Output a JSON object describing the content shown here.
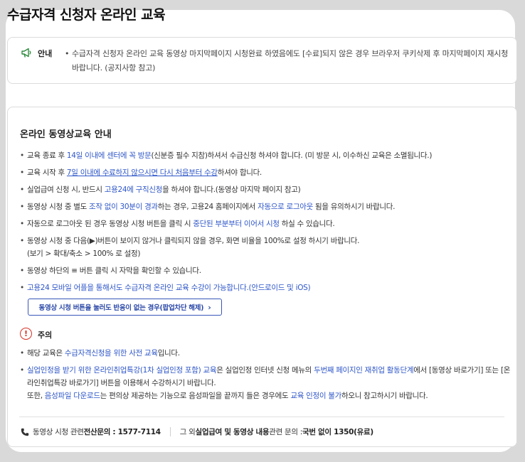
{
  "page": {
    "title": "수급자격 신청자 온라인 교육"
  },
  "notice": {
    "label": "안내",
    "bullet": "•",
    "text": "수급자격 신청자 온라인 교육 동영상 마지막페이지 시청완료 하였음에도 [수료]되지 않은 경우 브라우저 쿠키삭제 후 마지막페이지 재시청 바랍니다. (공지사항 참고)"
  },
  "guide": {
    "title": "온라인 동영상교육 안내",
    "items": [
      {
        "a": "교육 종료 후 ",
        "b": "14일 이내에 센터에 꼭 방문",
        "c": "(신분증 필수 지참)하셔서 수급신청 하셔야 합니다. (미 방문 시, 이수하신 교육은 소멸됩니다.)"
      },
      {
        "a": "교육 시작 후 ",
        "b": "7일 이내에 수료하지 않으시면 다시 처음부터 수강",
        "c": "하셔야 합니다."
      },
      {
        "a": "실업급여 신청 시, 반드시 ",
        "b": "고용24에 구직신청",
        "c": "을 하셔야 합니다.(동영상 마지막 페이지 참고)"
      },
      {
        "a": "동영상 시청 중 별도 ",
        "b": "조작 없이 30분이 경과",
        "c": "하는 경우, 고용24 홈페이지에서 ",
        "d": "자동으로 로그아웃",
        "e": " 됨을 유의하시기 바랍니다."
      },
      {
        "a": "자동으로 로그아웃 된 경우 동영상 시청 버튼을 클릭 시 ",
        "b": "중단된 부분부터 이어서 시청",
        "c": " 하실 수 있습니다."
      },
      {
        "a": "동영상 시청 중 다음(▶)버튼이 보이지 않거나 클릭되지 않을 경우, 화면 비율을 100%로 설정 하시기 바랍니다.",
        "b": "(보기 > 확대/축소 > 100% 로 설정)"
      },
      {
        "a": "동영상 하단의 ≡ 버튼 클릭 시 자막을 확인할 수 있습니다."
      },
      {
        "a": "고용24 모바일 어플을 통해서도 수급자격 온라인 교육 수강이 가능합니다.(안드로이드 및 iOS)"
      }
    ],
    "popup_button": "동영상 시청 버튼을 눌러도 반응이 없는 경우(팝업차단 해제)",
    "chevron": "›"
  },
  "caution": {
    "label": "주의",
    "symbol": "!",
    "items": [
      {
        "a": "해당 교육은 ",
        "b": "수급자격신청을 위한 사전 교육",
        "c": "입니다."
      },
      {
        "a": "실업인정을 받기 위한 온라인취업특강(1차 실업인정 포함) 교육",
        "b": "은 실업인정 인터넷 신청 메뉴의 ",
        "c": "두번째 페이지인 재취업 활동단계",
        "d": "에서 [동영상 바로가기] 또는 [온라인취업특강 바로가기] 버튼을 이용해서 수강하시기 바랍니다.",
        "e": "또한, ",
        "f": "음성파일 다운로드",
        "g": "는 편의상 제공하는 기능으로 음성파일을 끝까지 들은 경우에도 ",
        "h": "교육 인정이 불가",
        "i": "하오니 참고하시기 바랍니다."
      }
    ]
  },
  "footer": {
    "video_label": "동영상 시청 관련 ",
    "video_contact": "전산문의 : 1577-7114",
    "other_label_a": "그 외 ",
    "other_label_b": "실업급여 및 동영상 내용",
    "other_label_c": " 관련 문의 : ",
    "other_contact": "국번 없이 1350(유료)"
  },
  "colors": {
    "link": "#2f57c8",
    "danger": "#d93025",
    "notice_icon": "#2e8b3d"
  }
}
